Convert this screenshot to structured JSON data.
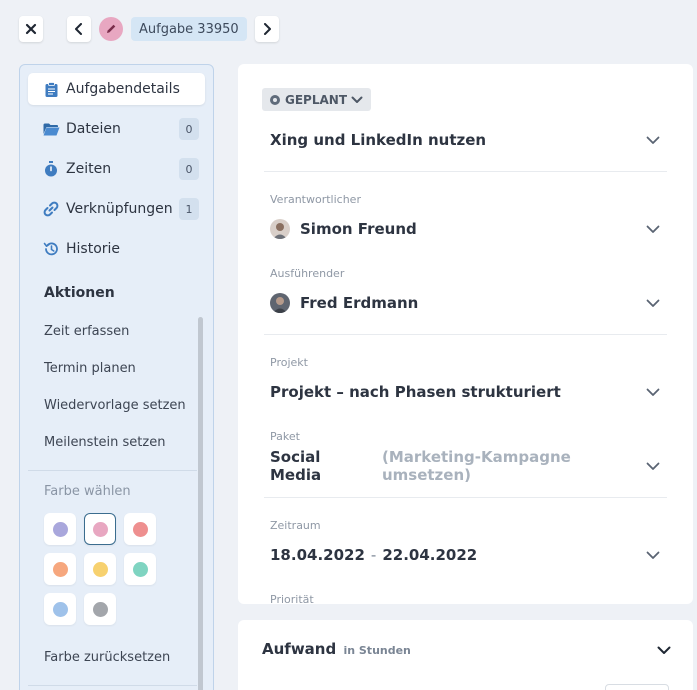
{
  "header": {
    "task_label": "Aufgabe 33950"
  },
  "sidebar": {
    "items": [
      {
        "label": "Aufgabendetails",
        "icon": "clipboard-icon",
        "count": ""
      },
      {
        "label": "Dateien",
        "icon": "folder-icon",
        "count": "0"
      },
      {
        "label": "Zeiten",
        "icon": "stopwatch-icon",
        "count": "0"
      },
      {
        "label": "Verknüpfungen",
        "icon": "link-icon",
        "count": "1"
      },
      {
        "label": "Historie",
        "icon": "history-icon",
        "count": ""
      }
    ],
    "actions_title": "Aktionen",
    "actions": [
      "Zeit erfassen",
      "Termin planen",
      "Wiedervorlage setzen",
      "Meilenstein setzen"
    ],
    "color_label": "Farbe wählen",
    "colors": [
      "#a9a7dc",
      "#e8a7c1",
      "#ee8f8f",
      "#f6a77e",
      "#f7d16f",
      "#7fd4c1",
      "#9fc2ea",
      "#a3a6ab"
    ],
    "selected_color": "#e8a7c1",
    "reset_label": "Farbe zurücksetzen"
  },
  "details": {
    "status": "GEPLANT",
    "title": "Xing und LinkedIn nutzen",
    "responsible_label": "Verantwortlicher",
    "responsible": "Simon Freund",
    "assignee_label": "Ausführender",
    "assignee": "Fred Erdmann",
    "project_label": "Projekt",
    "project": "Projekt – nach Phasen strukturiert",
    "package_label": "Paket",
    "package": "Social Media",
    "package_parent": "(Marketing-Kampagne umsetzen)",
    "period_label": "Zeitraum",
    "period_start": "18.04.2022",
    "period_sep": "-",
    "period_end": "22.04.2022",
    "priority_label": "Priorität"
  },
  "effort": {
    "title": "Aufwand",
    "unit": "in Stunden"
  }
}
